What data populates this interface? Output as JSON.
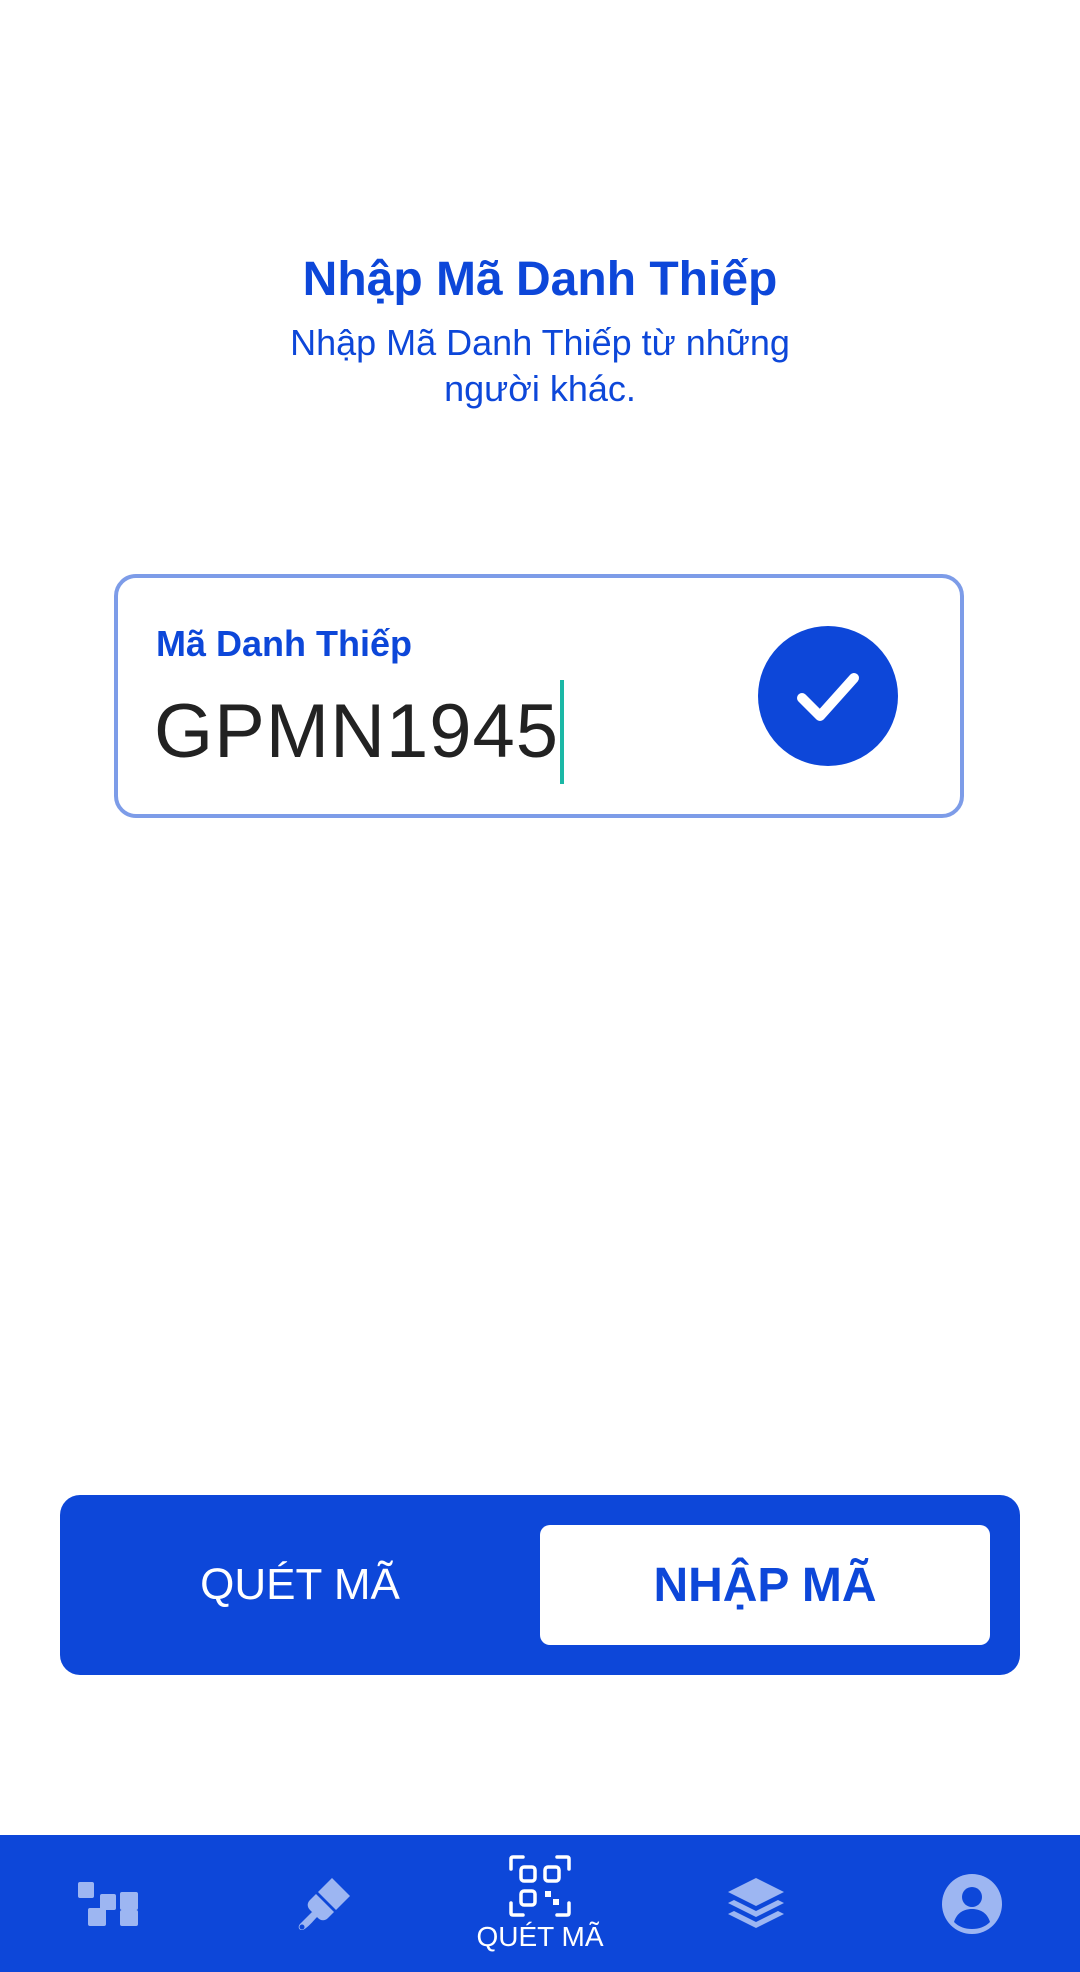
{
  "header": {
    "title": "Nhập Mã Danh Thiếp",
    "subtitle": "Nhập Mã Danh Thiếp từ những người khác."
  },
  "code_field": {
    "label": "Mã Danh Thiếp",
    "value": "GPMN1945",
    "confirm_icon": "check-icon"
  },
  "segment": {
    "scan_label": "QUÉT MÃ",
    "enter_label": "NHẬP MÃ",
    "selected": "enter"
  },
  "bottom_nav": {
    "items": [
      {
        "icon": "tiles-icon",
        "label": ""
      },
      {
        "icon": "brush-icon",
        "label": ""
      },
      {
        "icon": "qr-code-icon",
        "label": "QUÉT MÃ"
      },
      {
        "icon": "layers-icon",
        "label": ""
      },
      {
        "icon": "account-icon",
        "label": ""
      }
    ],
    "active_index": 2
  },
  "colors": {
    "primary": "#0d47d9",
    "field_border": "#7d9ce8",
    "caret": "#1bb8a6",
    "inactive_icon": "#9db6f2",
    "background": "#ffffff"
  }
}
